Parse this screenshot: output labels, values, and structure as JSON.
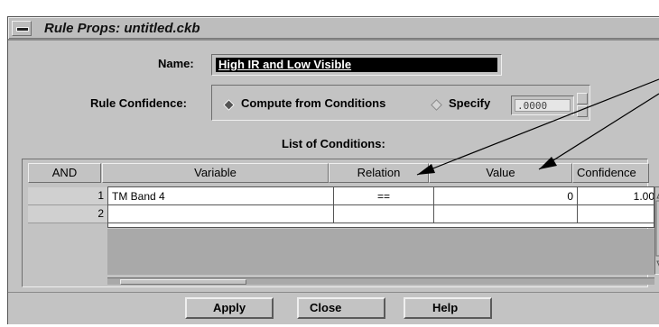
{
  "window": {
    "title": "Rule Props: untitled.ckb",
    "menu_icon": "window-menu-icon"
  },
  "form": {
    "name_label": "Name:",
    "name_value": "High IR and Low Visible",
    "confidence_label": "Rule Confidence:",
    "radio_compute_label": "Compute from Conditions",
    "radio_specify_label": "Specify",
    "selected_radio": "Compute from Conditions",
    "specify_value": ".0000",
    "conditions_label": "List of Conditions:"
  },
  "table": {
    "columns": [
      "AND",
      "Variable",
      "Relation",
      "Value",
      "Confidence"
    ],
    "rows": [
      {
        "and": "1",
        "variable": "TM Band 4",
        "relation": "==",
        "value": "0",
        "confidence": "1.00"
      },
      {
        "and": "2",
        "variable": "",
        "relation": "",
        "value": "",
        "confidence": ""
      }
    ]
  },
  "buttons": {
    "apply": "Apply",
    "close": "Close",
    "help": "Help"
  }
}
